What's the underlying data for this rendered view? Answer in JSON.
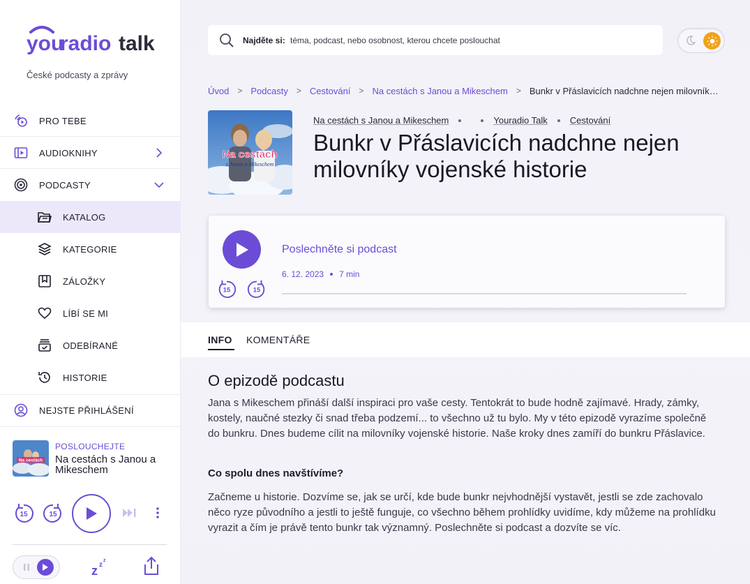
{
  "brand": {
    "logo_you": "you",
    "logo_radio": "radio",
    "logo_talk": "talk",
    "tagline": "České podcasty a zprávy"
  },
  "nav": {
    "pro_tebe": "PRO TEBE",
    "audioknihy": "AUDIOKNIHY",
    "podcasty": "PODCASTY",
    "sub": {
      "katalog": "KATALOG",
      "kategorie": "KATEGORIE",
      "zalozky": "ZÁLOŽKY",
      "libi": "LÍBÍ SE MI",
      "odebirane": "ODEBÍRANÉ",
      "historie": "HISTORIE"
    },
    "login": "NEJSTE PŘIHLÁŠENÍ"
  },
  "now_playing": {
    "label": "POSLOUCHEJTE",
    "title": "Na cestách s Janou a Mikeschem",
    "skip_label": "15"
  },
  "search": {
    "label": "Najděte si:",
    "placeholder": "téma, podcast, nebo osobnost, kterou chcete poslouchat"
  },
  "breadcrumbs": {
    "c1": "Úvod",
    "c2": "Podcasty",
    "c3": "Cestování",
    "c4": "Na cestách s Janou a Mikeschem",
    "c5": "Bunkr v Přáslavicích nadchne nejen milovníky vojenské historie"
  },
  "episode": {
    "show": "Na cestách s Janou a Mikeschem",
    "network": "Youradio Talk",
    "category": "Cestování",
    "title": "Bunkr v Přáslavicích nadchne nejen milovníky vojenské historie",
    "cover_text_1": "Na cestách",
    "cover_text_2": "s Janou a Mikeschem"
  },
  "player": {
    "title": "Poslechněte si podcast",
    "date": "6. 12. 2023",
    "duration": "7 min",
    "skip_label": "15",
    "progress": 0
  },
  "tabs": {
    "info": "INFO",
    "komentare": "KOMENTÁŘE"
  },
  "content": {
    "heading": "O epizodě podcastu",
    "p1": "Jana s Mikeschem přináší další inspiraci pro vaše cesty. Tentokrát to bude hodně zajímavé. Hrady, zámky, kostely, naučné stezky či snad třeba podzemí... to všechno už tu bylo. My v této epizodě vyrazíme společně do bunkru. Dnes budeme cílit na milovníky vojenské historie. Naše kroky dnes zamíří do bunkru Přáslavice.",
    "subheading": "Co spolu dnes navštívíme?",
    "p2": "Začneme u historie. Dozvíme se, jak se určí, kde bude bunkr nejvhodnější vystavět, jestli se zde zachovalo něco ryze původního a jestli to ještě funguje, co všechno během prohlídky uvidíme, kdy můžeme na prohlídku vyrazit a čím je právě tento bunkr tak významný. Poslechněte si podcast a dozvíte se víc."
  },
  "colors": {
    "accent": "#6c4cd6",
    "sun": "#f2a21b"
  }
}
